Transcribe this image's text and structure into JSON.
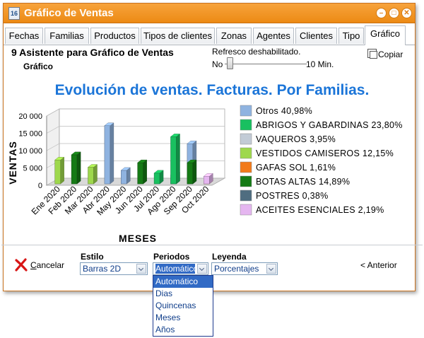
{
  "window": {
    "title": "Gráfico de Ventas",
    "app_icon": "16"
  },
  "tabs": [
    {
      "label": "Fechas",
      "active": false
    },
    {
      "label": "Familias",
      "active": false
    },
    {
      "label": "Productos",
      "active": false
    },
    {
      "label": "Tipos de clientes",
      "active": false
    },
    {
      "label": "Zonas",
      "active": false
    },
    {
      "label": "Agentes",
      "active": false
    },
    {
      "label": "Clientes",
      "active": false
    },
    {
      "label": "Tipo",
      "active": false
    },
    {
      "label": "Gráfico",
      "active": true
    }
  ],
  "wizard": {
    "title": "9 Asistente para Gráfico de Ventas",
    "subtitle": "Gráfico"
  },
  "refresh": {
    "label": "Refresco deshabilitado.",
    "min_label": "No",
    "max_label": "10 Min.",
    "value": 0
  },
  "copy_label": "Copiar",
  "chart_data": {
    "type": "bar",
    "title": "Evolución de ventas. Facturas. Por Familias.",
    "xlabel": "MESES",
    "ylabel": "VENTAS",
    "ylim": [
      0,
      20000
    ],
    "y_ticks": [
      "0",
      "5 000",
      "10 000",
      "15 000",
      "20 000"
    ],
    "grid": true,
    "legend_position": "right",
    "categories": [
      "Ene 2020",
      "Feb 2020",
      "Mar 2020",
      "Abr 2020",
      "May 2020",
      "Jun 2020",
      "Jul 2020",
      "Ago 2020",
      "Sep 2020",
      "Oct 2020"
    ],
    "series": [
      {
        "name": "Otros 40,98%",
        "color": "#8fb3e0",
        "values": [
          0,
          0,
          0,
          17200,
          4300,
          0,
          0,
          3000,
          12000,
          0
        ]
      },
      {
        "name": "ABRIGOS Y GABARDINAS 23,80%",
        "color": "#19c060",
        "values": [
          0,
          0,
          0,
          0,
          0,
          0,
          3500,
          14000,
          0,
          0
        ]
      },
      {
        "name": "VAQUEROS 3,95%",
        "color": "#c2cbd6",
        "values": [
          0,
          0,
          0,
          0,
          0,
          0,
          0,
          0,
          0,
          0
        ]
      },
      {
        "name": "VESTIDOS CAMISEROS 12,15%",
        "color": "#9ed84c",
        "values": [
          7300,
          0,
          5200,
          0,
          0,
          0,
          0,
          0,
          0,
          0
        ]
      },
      {
        "name": "GAFAS SOL 1,61%",
        "color": "#f27a1a",
        "values": [
          0,
          0,
          0,
          0,
          0,
          0,
          0,
          0,
          0,
          1200
        ]
      },
      {
        "name": "BOTAS ALTAS 14,89%",
        "color": "#157a15",
        "values": [
          0,
          8800,
          0,
          0,
          0,
          6500,
          0,
          0,
          6500,
          0
        ]
      },
      {
        "name": "POSTRES 0,38%",
        "color": "#4f6d80",
        "values": [
          0,
          0,
          0,
          0,
          0,
          0,
          0,
          0,
          0,
          0
        ]
      },
      {
        "name": "ACEITES ESENCIALES 2,19%",
        "color": "#e5b6f0",
        "values": [
          0,
          0,
          0,
          0,
          0,
          0,
          0,
          0,
          0,
          2600
        ]
      }
    ]
  },
  "footer": {
    "cancel_label": "Cancelar",
    "estilo": {
      "label": "Estilo",
      "value": "Barras 2D"
    },
    "periodos": {
      "label": "Periodos",
      "value": "Automático",
      "options": [
        "Automático",
        "Dias",
        "Quincenas",
        "Meses",
        "Años"
      ],
      "selected_index": 0
    },
    "leyenda": {
      "label": "Leyenda",
      "value": "Porcentajes"
    },
    "anterior_label": "< Anterior"
  }
}
